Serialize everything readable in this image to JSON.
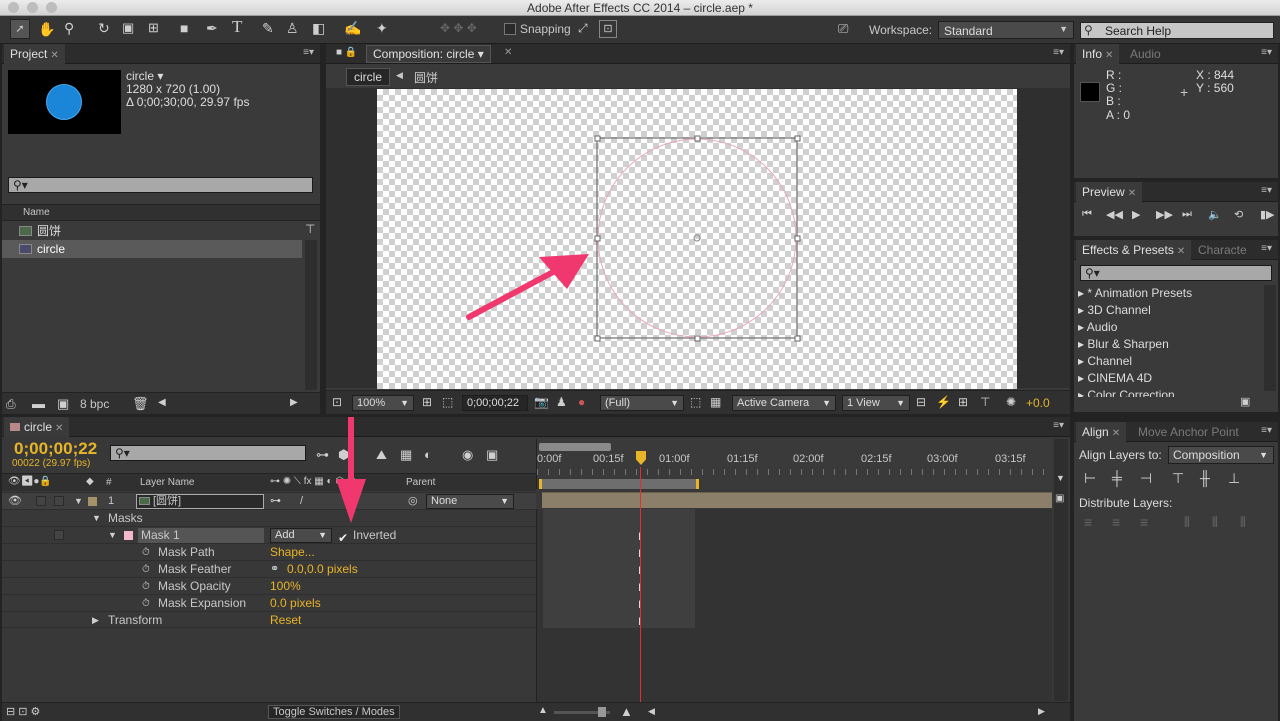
{
  "title": "Adobe After Effects CC 2014 – circle.aep *",
  "toolbar": {
    "snapping_label": "Snapping",
    "workspace_label": "Workspace:",
    "workspace_value": "Standard",
    "search_placeholder": "Search Help"
  },
  "project": {
    "tab": "Project",
    "comp_name": "circle ▾",
    "comp_size": "1280 x 720 (1.00)",
    "comp_duration": "Δ 0;00;30;00, 29.97 fps",
    "name_header": "Name",
    "items": [
      {
        "name": "圆饼",
        "selected": false
      },
      {
        "name": "circle",
        "selected": true
      }
    ],
    "bpc": "8 bpc"
  },
  "composition": {
    "tab": "Composition: circle",
    "breadcrumb_current": "circle",
    "breadcrumb_child": "圆饼",
    "zoom": "100%",
    "timecode": "0;00;00;22",
    "resolution": "(Full)",
    "camera": "Active Camera",
    "views": "1 View",
    "exposure": "+0.0"
  },
  "info": {
    "tab": "Info",
    "tab2": "Audio",
    "r": "R :",
    "g": "G :",
    "b": "B :",
    "a": "A : 0",
    "x": "X : 844",
    "y": "Y : 560"
  },
  "preview": {
    "tab": "Preview"
  },
  "effects": {
    "tab": "Effects & Presets",
    "tab2": "Characte",
    "items": [
      "* Animation Presets",
      "3D Channel",
      "Audio",
      "Blur & Sharpen",
      "Channel",
      "CINEMA 4D",
      "Color Correction"
    ]
  },
  "timeline": {
    "tab": "circle",
    "timecode": "0;00;00;22",
    "frame_info": "00022 (29.97 fps)",
    "col_layer_name": "Layer Name",
    "col_parent": "Parent",
    "layer": {
      "num": "1",
      "name": "[圆饼]",
      "parent": "None"
    },
    "masks_label": "Masks",
    "mask1": {
      "name": "Mask 1",
      "mode": "Add",
      "inverted_label": "Inverted"
    },
    "props": [
      {
        "name": "Mask Path",
        "value": "Shape..."
      },
      {
        "name": "Mask Feather",
        "value": "0.0,0.0 pixels"
      },
      {
        "name": "Mask Opacity",
        "value": "100%"
      },
      {
        "name": "Mask Expansion",
        "value": "0.0 pixels"
      }
    ],
    "transform_label": "Transform",
    "transform_value": "Reset",
    "toggle_label": "Toggle Switches / Modes",
    "ruler": [
      "0:00f",
      "00:15f",
      "01:00f",
      "01:15f",
      "02:00f",
      "02:15f",
      "03:00f",
      "03:15f"
    ]
  },
  "align": {
    "tab": "Align",
    "tab2": "Move Anchor Point",
    "align_to_label": "Align Layers to:",
    "align_to_value": "Composition",
    "distribute_label": "Distribute Layers:"
  },
  "colors": {
    "accent_yellow": "#e8b428",
    "arrow_pink": "#f0386f",
    "circle_blue": "#1b86d8",
    "mask_color": "#f4b8c8"
  }
}
